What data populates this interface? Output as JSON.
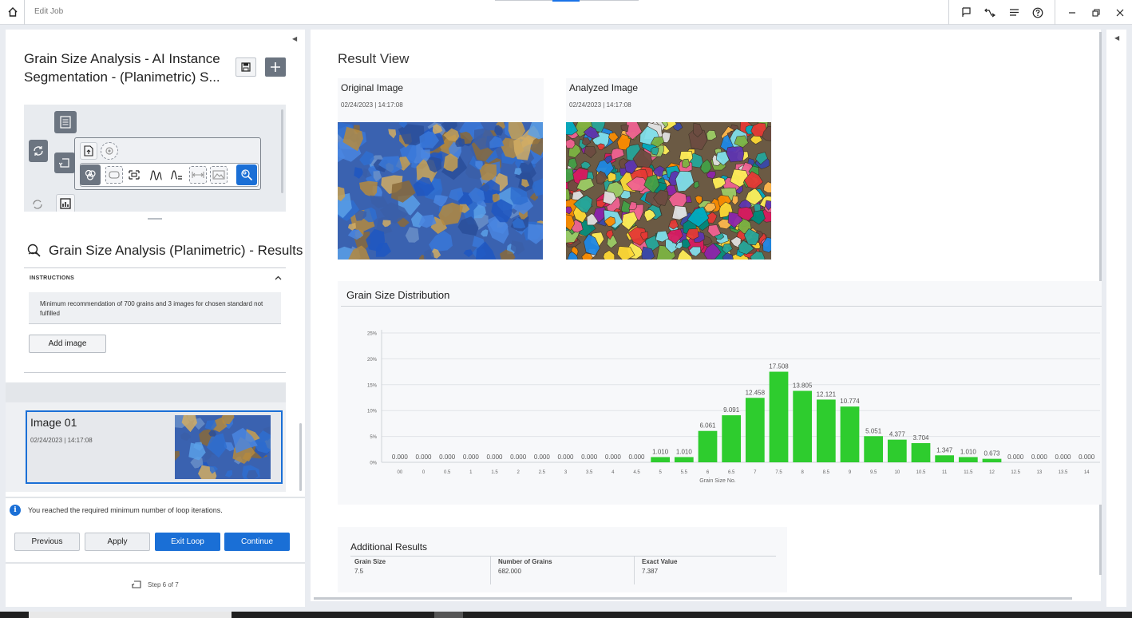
{
  "titlebar": {
    "title": "Edit Job",
    "icons": [
      "home-icon",
      "feedback-flag-icon",
      "connect-icon",
      "menu-icon",
      "help-icon",
      "minimize-icon",
      "restore-icon",
      "close-icon"
    ]
  },
  "job": {
    "title": "Grain Size Analysis - AI Instance Segmentation - (Planimetric) S..."
  },
  "results": {
    "title": "Grain Size Analysis (Planimetric) - Results",
    "instructions_label": "INSTRUCTIONS",
    "instructions_text": "Minimum recommendation of 700 grains and 3 images for chosen standard not fulfilled",
    "add_image_label": "Add image"
  },
  "image_list": [
    {
      "name": "Image 01",
      "date": "02/24/2023 | 14:17:08"
    }
  ],
  "footer": {
    "info_message": "You reached the required minimum number of loop iterations.",
    "buttons": {
      "previous": "Previous",
      "apply": "Apply",
      "exit_loop": "Exit Loop",
      "continue": "Continue"
    },
    "step_label": "Step 6 of 7"
  },
  "result_view": {
    "title": "Result View",
    "original": {
      "label": "Original Image",
      "date": "02/24/2023 | 14:17:08"
    },
    "analyzed": {
      "label": "Analyzed Image",
      "date": "02/24/2023 | 14:17:08"
    }
  },
  "chart_data": {
    "type": "bar",
    "title": "Grain Size Distribution",
    "xlabel": "Grain Size No.",
    "ylabel": "",
    "ylim": [
      0,
      25
    ],
    "yticks": [
      "0%",
      "5%",
      "10%",
      "15%",
      "20%",
      "25%"
    ],
    "categories": [
      "00",
      "0",
      "0.5",
      "1",
      "1.5",
      "2",
      "2.5",
      "3",
      "3.5",
      "4",
      "4.5",
      "5",
      "5.5",
      "6",
      "6.5",
      "7",
      "7.5",
      "8",
      "8.5",
      "9",
      "9.5",
      "10",
      "10.5",
      "11",
      "11.5",
      "12",
      "12.5",
      "13",
      "13.5",
      "14"
    ],
    "values": [
      0.0,
      0.0,
      0.0,
      0.0,
      0.0,
      0.0,
      0.0,
      0.0,
      0.0,
      0.0,
      0.0,
      1.01,
      1.01,
      6.061,
      9.091,
      12.458,
      17.508,
      13.805,
      12.121,
      10.774,
      5.051,
      4.377,
      3.704,
      1.347,
      1.01,
      0.673,
      0.0,
      0.0,
      0.0,
      0.0
    ],
    "labels": [
      "0.000",
      "0.000",
      "0.000",
      "0.000",
      "0.000",
      "0.000",
      "0.000",
      "0.000",
      "0.000",
      "0.000",
      "0.000",
      "1.010",
      "1.010",
      "6.061",
      "9.091",
      "12.458",
      "17.508",
      "13.805",
      "12.121",
      "10.774",
      "5.051",
      "4.377",
      "3.704",
      "1.347",
      "1.010",
      "0.673",
      "0.000",
      "0.000",
      "0.000",
      "0.000"
    ],
    "bar_color": "#2ecc2e",
    "grid": true
  },
  "additional_results": {
    "title": "Additional Results",
    "items": [
      {
        "key": "Grain Size",
        "value": "7.5"
      },
      {
        "key": "Number of Grains",
        "value": "682.000"
      },
      {
        "key": "Exact Value",
        "value": "7.387"
      }
    ]
  },
  "colors": {
    "primary": "#1a6fd6",
    "bar": "#2ecc2e"
  }
}
